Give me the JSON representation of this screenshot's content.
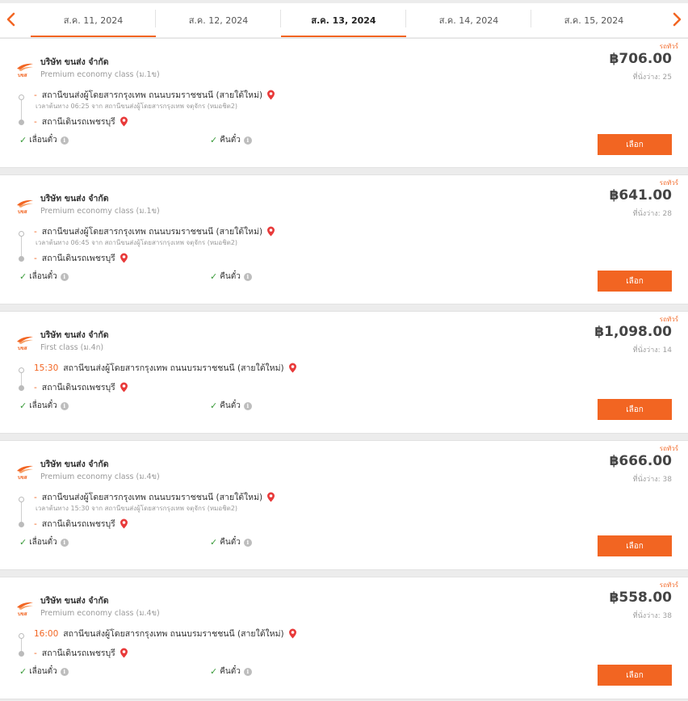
{
  "colors": {
    "accent": "#f26522",
    "check": "#3a9b3a",
    "pin": "#e83a3a"
  },
  "datebar": {
    "prev_icon": "chevron-left-icon",
    "next_icon": "chevron-right-icon",
    "tabs": [
      {
        "label": "ส.ค. 11, 2024",
        "active": false
      },
      {
        "label": "ส.ค. 12, 2024",
        "active": false
      },
      {
        "label": "ส.ค. 13, 2024",
        "active": true
      },
      {
        "label": "ส.ค. 14, 2024",
        "active": false
      },
      {
        "label": "ส.ค. 15, 2024",
        "active": false
      }
    ]
  },
  "trips": [
    {
      "badge": "รถทัวร์",
      "company": "บริษัท ขนส่ง จำกัด",
      "bus_class": "Premium economy class (ม.1ข)",
      "origin_prefix": "-",
      "origin": "สถานีขนส่งผู้โดยสารกรุงเทพ ถนนบรมราชชนนี (สายใต้ใหม่)",
      "detail": "เวลาต้นทาง 06:25  จาก สถานีขนส่งผู้โดยสารกรุงเทพ จตุจักร (หมอชิต2)",
      "dest_prefix": "-",
      "destination": "สถานีเดินรถเพชรบุรี",
      "policy_change": "เลื่อนตั๋ว",
      "policy_refund": "คืนตั๋ว",
      "price": "฿706.00",
      "seats": "ที่นั่งว่าง: 25",
      "button": "เลือก"
    },
    {
      "badge": "รถทัวร์",
      "company": "บริษัท ขนส่ง จำกัด",
      "bus_class": "Premium economy class (ม.1ข)",
      "origin_prefix": "-",
      "origin": "สถานีขนส่งผู้โดยสารกรุงเทพ ถนนบรมราชชนนี (สายใต้ใหม่)",
      "detail": "เวลาต้นทาง 06:45  จาก สถานีขนส่งผู้โดยสารกรุงเทพ จตุจักร (หมอชิต2)",
      "dest_prefix": "-",
      "destination": "สถานีเดินรถเพชรบุรี",
      "policy_change": "เลื่อนตั๋ว",
      "policy_refund": "คืนตั๋ว",
      "price": "฿641.00",
      "seats": "ที่นั่งว่าง: 28",
      "button": "เลือก"
    },
    {
      "badge": "รถทัวร์",
      "company": "บริษัท ขนส่ง จำกัด",
      "bus_class": "First class (ม.4ก)",
      "origin_prefix": "15:30",
      "origin": "สถานีขนส่งผู้โดยสารกรุงเทพ ถนนบรมราชชนนี (สายใต้ใหม่)",
      "detail": "",
      "dest_prefix": "-",
      "destination": "สถานีเดินรถเพชรบุรี",
      "policy_change": "เลื่อนตั๋ว",
      "policy_refund": "คืนตั๋ว",
      "price": "฿1,098.00",
      "seats": "ที่นั่งว่าง: 14",
      "button": "เลือก"
    },
    {
      "badge": "รถทัวร์",
      "company": "บริษัท ขนส่ง จำกัด",
      "bus_class": "Premium economy class (ม.4ข)",
      "origin_prefix": "-",
      "origin": "สถานีขนส่งผู้โดยสารกรุงเทพ ถนนบรมราชชนนี (สายใต้ใหม่)",
      "detail": "เวลาต้นทาง 15:30  จาก สถานีขนส่งผู้โดยสารกรุงเทพ จตุจักร (หมอชิต2)",
      "dest_prefix": "-",
      "destination": "สถานีเดินรถเพชรบุรี",
      "policy_change": "เลื่อนตั๋ว",
      "policy_refund": "คืนตั๋ว",
      "price": "฿666.00",
      "seats": "ที่นั่งว่าง: 38",
      "button": "เลือก"
    },
    {
      "badge": "รถทัวร์",
      "company": "บริษัท ขนส่ง จำกัด",
      "bus_class": "Premium economy class (ม.4ข)",
      "origin_prefix": "16:00",
      "origin": "สถานีขนส่งผู้โดยสารกรุงเทพ ถนนบรมราชชนนี (สายใต้ใหม่)",
      "detail": "",
      "dest_prefix": "-",
      "destination": "สถานีเดินรถเพชรบุรี",
      "policy_change": "เลื่อนตั๋ว",
      "policy_refund": "คืนตั๋ว",
      "price": "฿558.00",
      "seats": "ที่นั่งว่าง: 38",
      "button": "เลือก"
    }
  ]
}
